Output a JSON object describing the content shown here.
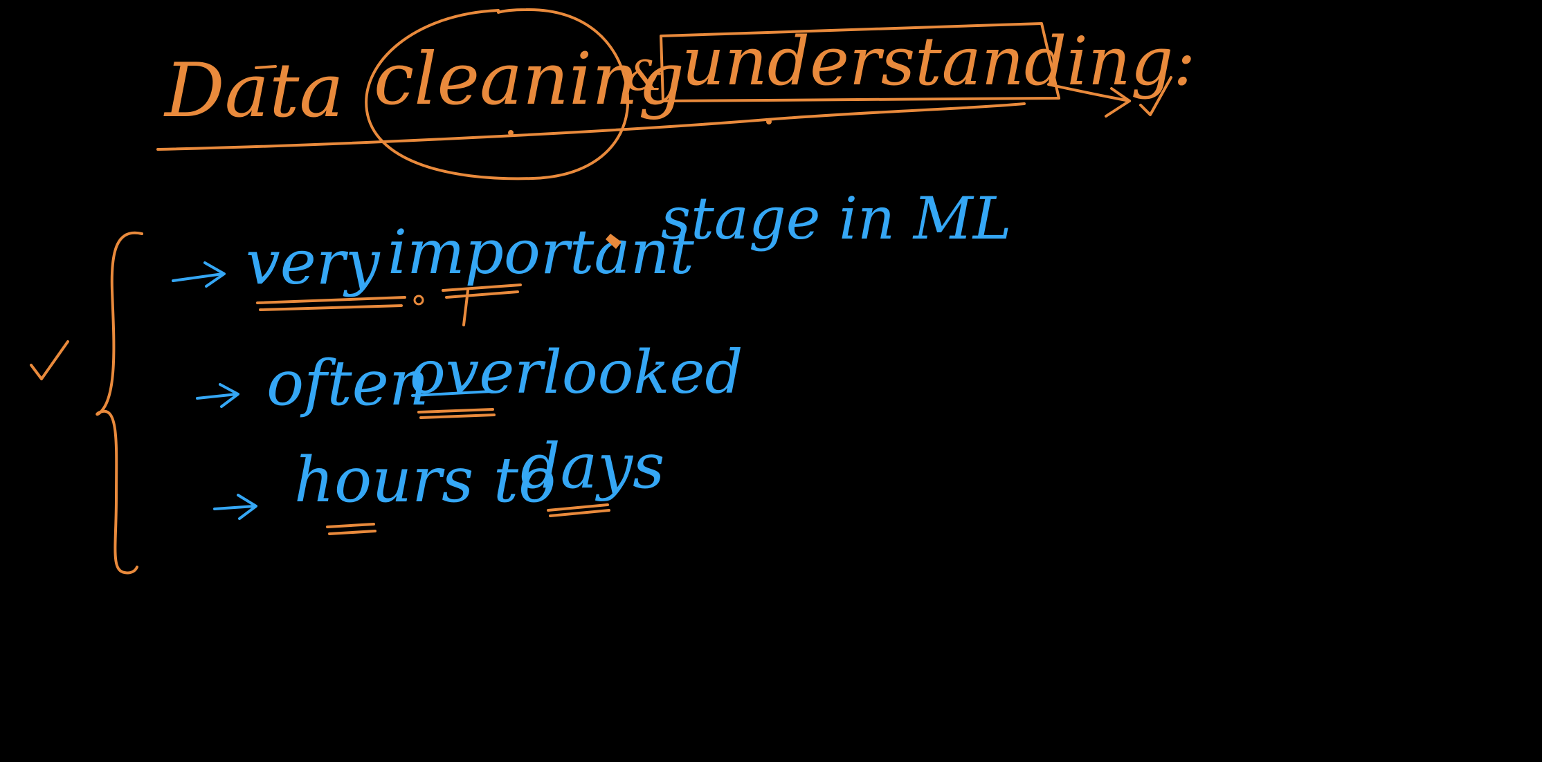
{
  "colors": {
    "background": "#000000",
    "orange_ink": "#e98a3c",
    "blue_ink": "#35a7f5"
  },
  "title": {
    "word1": "Data",
    "word2": "cleaning",
    "ampersand": "&",
    "word3": "understanding:"
  },
  "bullets": [
    {
      "text_part1": "very",
      "text_part2": "important",
      "text_part3": "stage in ML"
    },
    {
      "text_part1": "often",
      "text_part2": "overlooked"
    },
    {
      "text_part1": "hours to",
      "text_part2": "days"
    }
  ],
  "marks": {
    "checkmark_icon": "check-icon",
    "arrow_icon": "arrow-right-icon",
    "brace_icon": "curly-brace-icon",
    "pencil_cursor_icon": "pencil-cursor-icon"
  }
}
